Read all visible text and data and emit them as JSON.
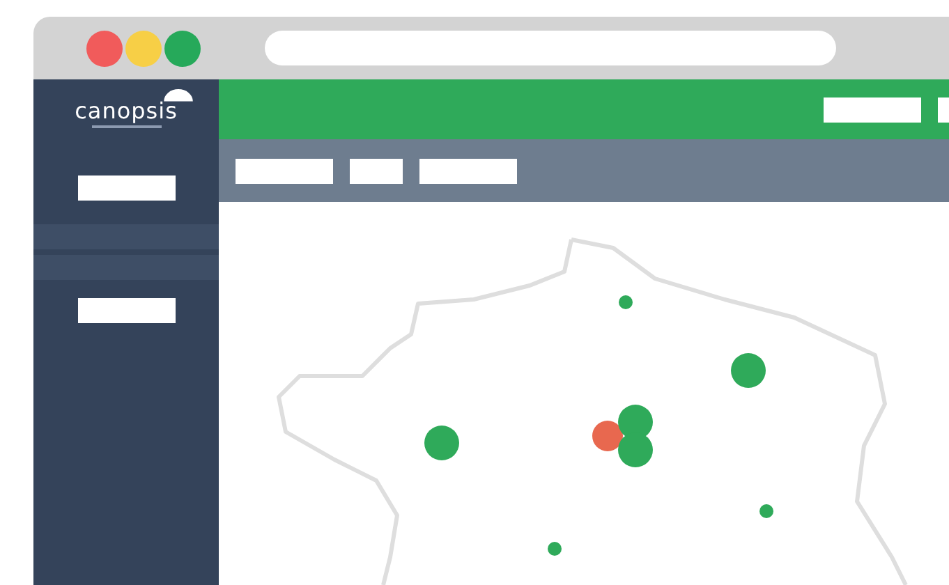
{
  "logo": {
    "text": "canopsis"
  },
  "map": {
    "markers": [
      {
        "kind": "small",
        "color": "#2faa5a"
      },
      {
        "kind": "large",
        "color": "#2faa5a"
      },
      {
        "kind": "large",
        "color": "#2faa5a"
      },
      {
        "kind": "medium",
        "color": "#e8684f"
      },
      {
        "kind": "large",
        "color": "#2faa5a"
      },
      {
        "kind": "large",
        "color": "#2faa5a"
      },
      {
        "kind": "small",
        "color": "#2faa5a"
      },
      {
        "kind": "small",
        "color": "#2faa5a"
      }
    ]
  }
}
